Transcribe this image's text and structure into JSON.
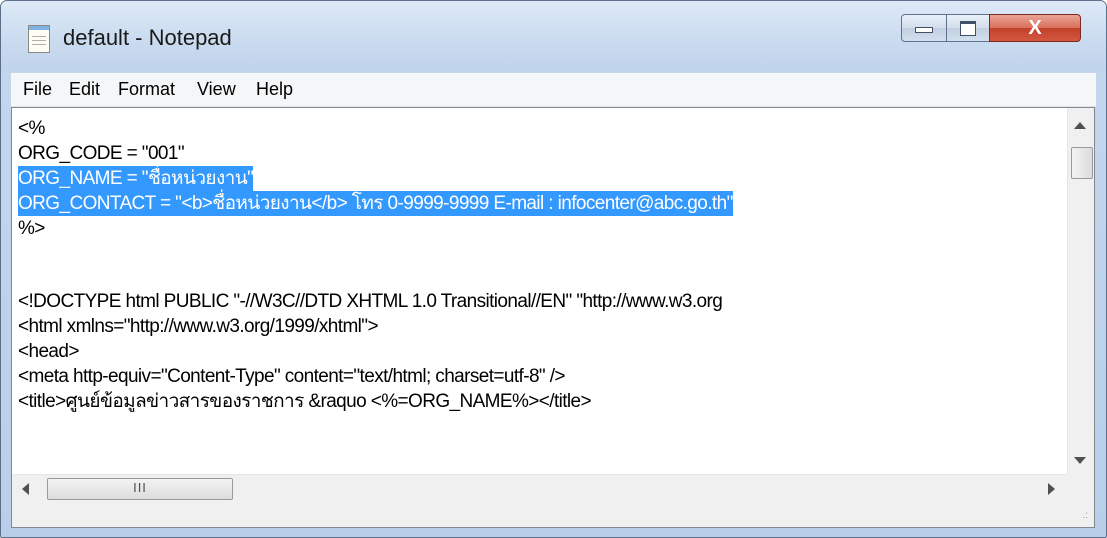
{
  "window": {
    "title": "default - Notepad"
  },
  "controls": {
    "minimize": "minimize",
    "maximize": "maximize",
    "close": "X"
  },
  "menu": [
    "File",
    "Edit",
    "Format",
    "View",
    "Help"
  ],
  "editor": {
    "lines": [
      {
        "text": "<%",
        "selected": false
      },
      {
        "text": "ORG_CODE = \"001\"",
        "selected": false
      },
      {
        "text": "ORG_NAME = \"ชื่อหน่วยงาน\"",
        "selected": true
      },
      {
        "text": "ORG_CONTACT = \"<b>ชื่อหน่วยงาน</b> โทร 0-9999-9999 E-mail : infocenter@abc.go.th\"",
        "selected": true
      },
      {
        "text": "%>",
        "selected": false
      },
      {
        "text": "",
        "selected": false
      },
      {
        "text": "<!DOCTYPE html PUBLIC \"-//W3C//DTD XHTML 1.0 Transitional//EN\" \"http://www.w3.org",
        "selected": false
      },
      {
        "text": "<html xmlns=\"http://www.w3.org/1999/xhtml\">",
        "selected": false
      },
      {
        "text": "<head>",
        "selected": false
      },
      {
        "text": "<meta http-equiv=\"Content-Type\" content=\"text/html; charset=utf-8\" />",
        "selected": false
      },
      {
        "text": "<title>ศูนย์ข้อมูลข่าวสารของราชการ &raquo <%=ORG_NAME%></title>",
        "selected": false
      }
    ]
  },
  "scrollbar": {
    "hthumb_label": "III"
  },
  "colors": {
    "selection": "#3399ff",
    "titlebar": "#c3d6ee",
    "close_button": "#c1412a"
  }
}
